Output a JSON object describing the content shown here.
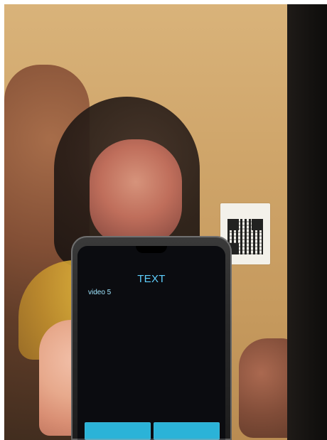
{
  "phone_app": {
    "title": "TEXT",
    "subtitle": "video 5"
  },
  "icons": {
    "qr_code": "qr-code-icon"
  },
  "colors": {
    "screen_bg": "#0b0c10",
    "title_color": "#5fd0ff",
    "button_color": "#2bb3d8"
  }
}
